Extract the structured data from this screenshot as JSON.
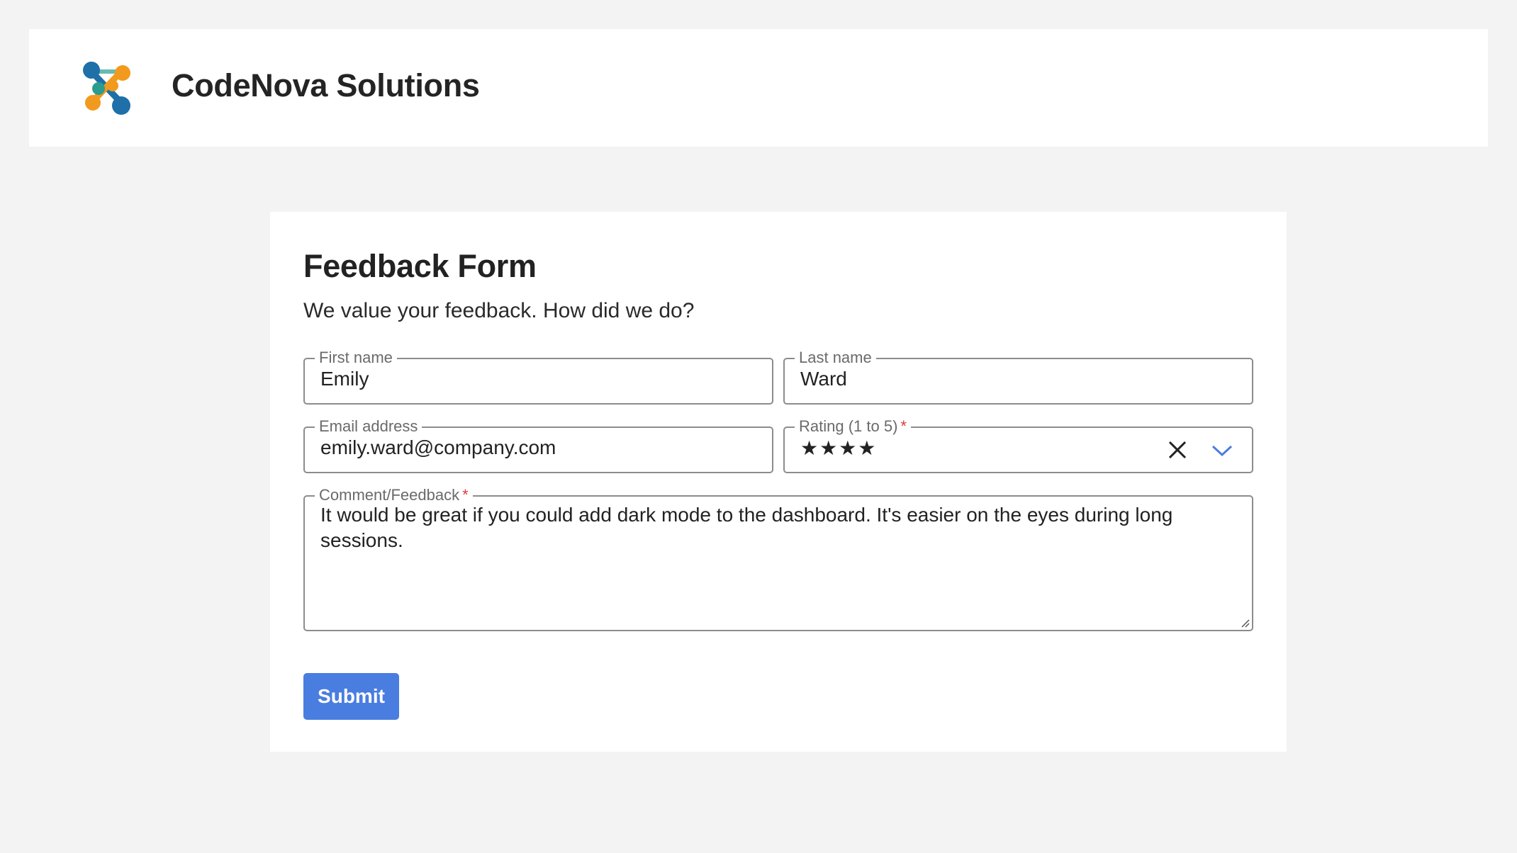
{
  "header": {
    "brand_name": "CodeNova Solutions",
    "logo_icon": "molecule-logo-icon"
  },
  "form": {
    "title": "Feedback Form",
    "subtitle": "We value your feedback. How did we do?",
    "first_name": {
      "label": "First name",
      "value": "Emily"
    },
    "last_name": {
      "label": "Last name",
      "value": "Ward"
    },
    "email": {
      "label": "Email address",
      "value": "emily.ward@company.com"
    },
    "rating": {
      "label": "Rating (1 to 5)",
      "required_mark": "*",
      "value": "★★★★"
    },
    "comment": {
      "label": "Comment/Feedback",
      "required_mark": "*",
      "value": "It would be great if you could add dark mode to the dashboard. It's easier on the eyes during long sessions."
    },
    "submit_label": "Submit"
  },
  "colors": {
    "accent": "#4a7de0",
    "required": "#e03a3a",
    "background": "#f3f3f3"
  }
}
